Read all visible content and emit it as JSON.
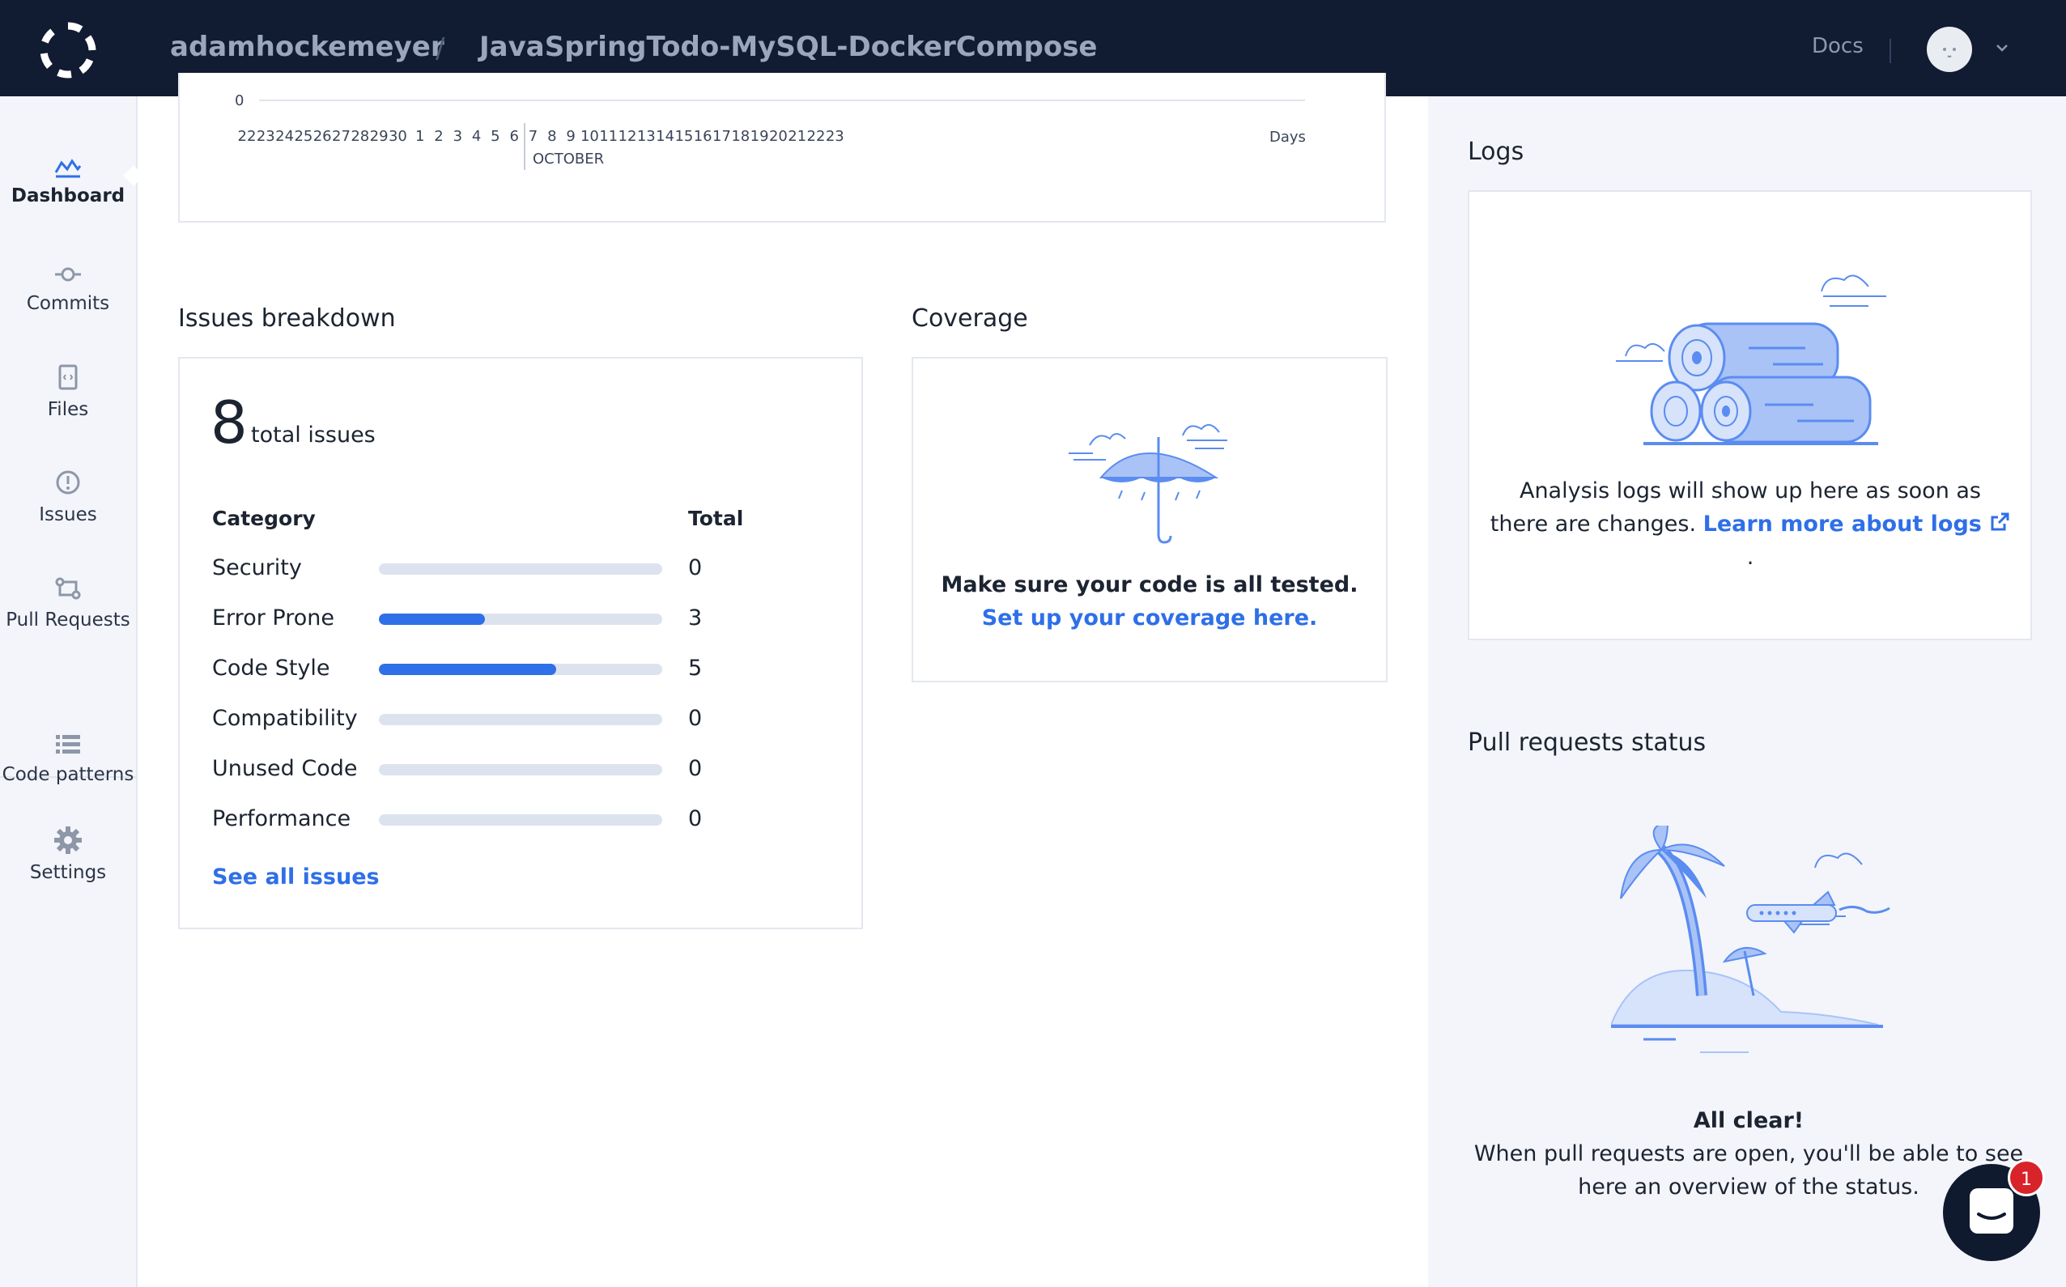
{
  "header": {
    "owner": "adamhockemeyer",
    "separator": "/",
    "repo": "JavaSpringTodo-MySQL-DockerCompose",
    "docs_label": "Docs"
  },
  "sidebar": {
    "items": [
      {
        "label": "Dashboard",
        "icon": "dashboard-icon",
        "active": true
      },
      {
        "label": "Commits",
        "icon": "commit-icon"
      },
      {
        "label": "Files",
        "icon": "file-icon"
      },
      {
        "label": "Issues",
        "icon": "issue-icon"
      },
      {
        "label": "Pull Requests",
        "icon": "pull-request-icon"
      },
      {
        "label": "Code patterns",
        "icon": "list-icon"
      },
      {
        "label": "Settings",
        "icon": "gear-icon"
      }
    ]
  },
  "timeline": {
    "zero_label": "0",
    "day_labels": [
      "22",
      "23",
      "24",
      "25",
      "26",
      "27",
      "28",
      "29",
      "30",
      "1",
      "2",
      "3",
      "4",
      "5",
      "6",
      "7",
      "8",
      "9",
      "10",
      "11",
      "12",
      "13",
      "14",
      "15",
      "16",
      "17",
      "18",
      "19",
      "20",
      "21",
      "22",
      "23"
    ],
    "month_label": "OCTOBER",
    "days_label": "Days"
  },
  "issues": {
    "section_title": "Issues breakdown",
    "count": "8",
    "count_label": "total issues",
    "col_category": "Category",
    "col_total": "Total",
    "max_total": 8,
    "rows": [
      {
        "category": "Security",
        "total": 0
      },
      {
        "category": "Error Prone",
        "total": 3
      },
      {
        "category": "Code Style",
        "total": 5
      },
      {
        "category": "Compatibility",
        "total": 0
      },
      {
        "category": "Unused Code",
        "total": 0
      },
      {
        "category": "Performance",
        "total": 0
      }
    ],
    "see_all": "See all issues"
  },
  "coverage": {
    "section_title": "Coverage",
    "message": "Make sure your code is all tested.",
    "link_text": "Set up your coverage here."
  },
  "logs": {
    "section_title": "Logs",
    "message": "Analysis logs will show up here as soon as there are changes.",
    "link_text": "Learn more about logs",
    "trailing": "."
  },
  "pull_requests": {
    "section_title": "Pull requests status",
    "title": "All clear!",
    "message": "When pull requests are open, you'll be able to see here an overview of the status."
  },
  "chat": {
    "badge_count": "1"
  },
  "colors": {
    "accent": "#2f6fe8",
    "topbar": "#111c33",
    "sidebar_bg": "#f3f5fa",
    "illustration": "#5b8cf0"
  }
}
